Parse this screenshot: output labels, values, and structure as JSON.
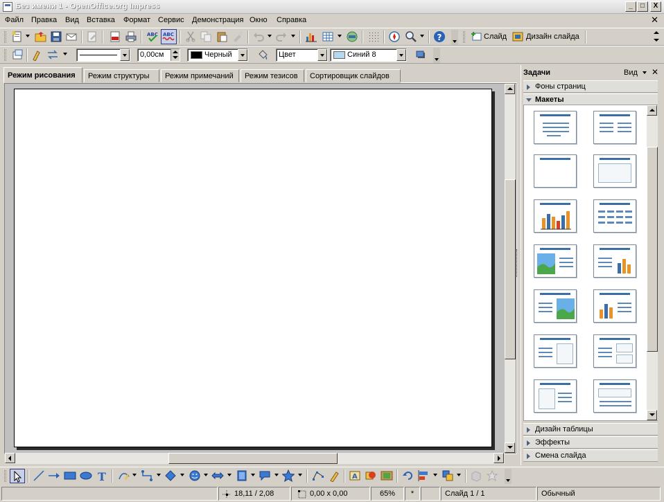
{
  "window": {
    "title": "Без имени 1 - OpenOffice.org Impress",
    "minimize": "_",
    "maximize": "□",
    "close": "X",
    "doc_close": "✕"
  },
  "menu": [
    "Файл",
    "Правка",
    "Вид",
    "Вставка",
    "Формат",
    "Сервис",
    "Демонстрация",
    "Окно",
    "Справка"
  ],
  "standard_toolbar": {
    "slide_label": "Слайд",
    "slide_design_label": "Дизайн слайда"
  },
  "line_toolbar": {
    "line_width": "0,00см",
    "line_color": "Черный",
    "area_style": "Цвет",
    "area_fill": "Синий 8",
    "line_color_swatch": "#000000",
    "area_fill_swatch": "#b4d8f0"
  },
  "view_tabs": [
    "Режим рисования",
    "Режим структуры",
    "Режим примечаний",
    "Режим тезисов",
    "Сортировщик слайдов"
  ],
  "task_pane": {
    "title": "Задачи",
    "view_menu": "Вид",
    "close": "✕",
    "panels_top": [
      "Фоны страниц"
    ],
    "panel_open": "Макеты",
    "panels_bottom": [
      "Дизайн таблицы",
      "Эффекты",
      "Смена слайда"
    ]
  },
  "status_bar": {
    "position": "18,11 / 2,08",
    "size": "0,00 x 0,00",
    "zoom": "65%",
    "modified": "*",
    "slide": "Слайд 1 / 1",
    "layout": "Обычный"
  },
  "colors": {
    "accent_blue": "#3a6ea5",
    "chart_orange": "#e8922a",
    "chart_blue": "#3a6ea5",
    "green_image": "#4aa84a",
    "sky": "#6ab0e8"
  }
}
